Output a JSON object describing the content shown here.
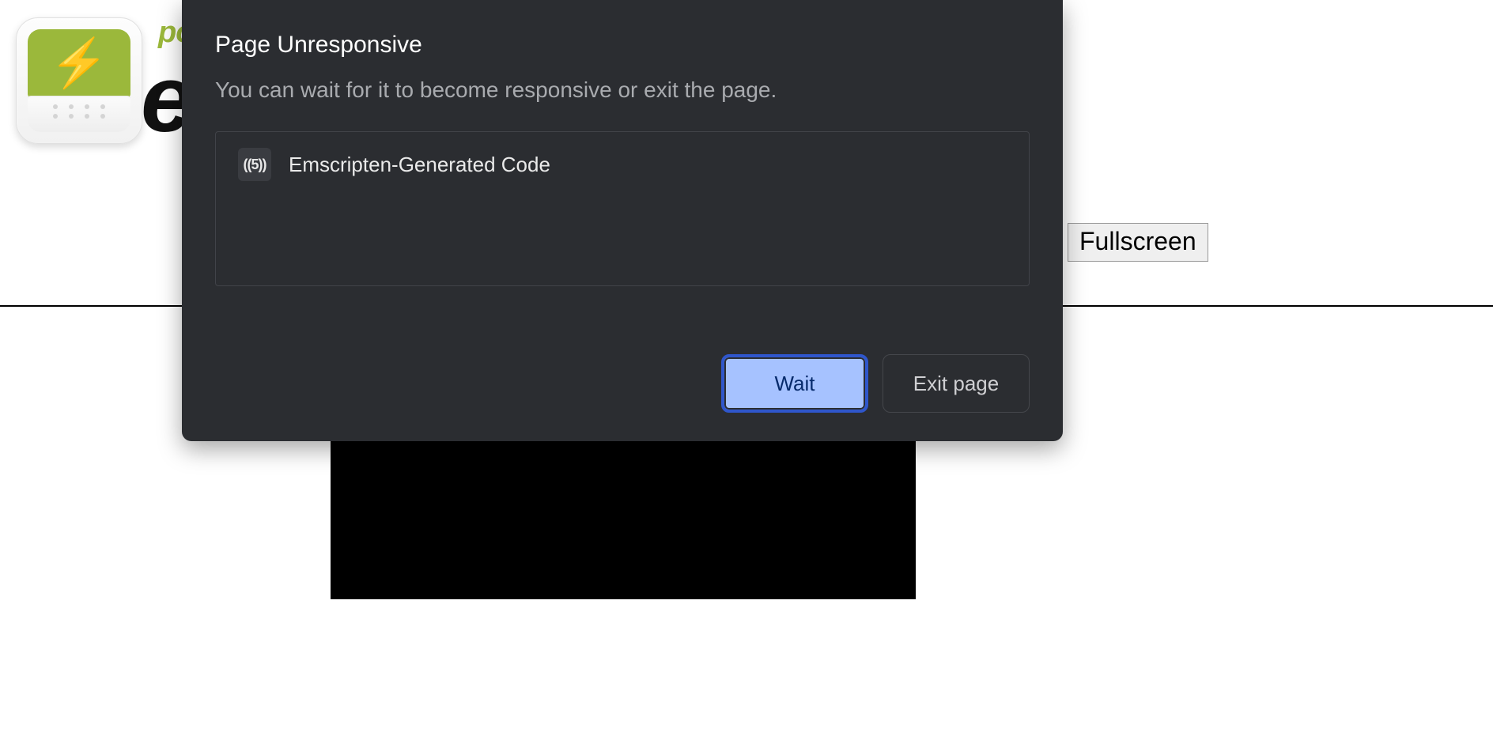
{
  "brand": {
    "powered_prefix": "po",
    "name_fragment": "e"
  },
  "controls": {
    "fullscreen_label": "Fullscreen"
  },
  "dialog": {
    "title": "Page Unresponsive",
    "message": "You can wait for it to become responsive or exit the page.",
    "favicon_text": "((5))",
    "page_title": "Emscripten-Generated Code",
    "buttons": {
      "wait": "Wait",
      "exit": "Exit page"
    }
  }
}
